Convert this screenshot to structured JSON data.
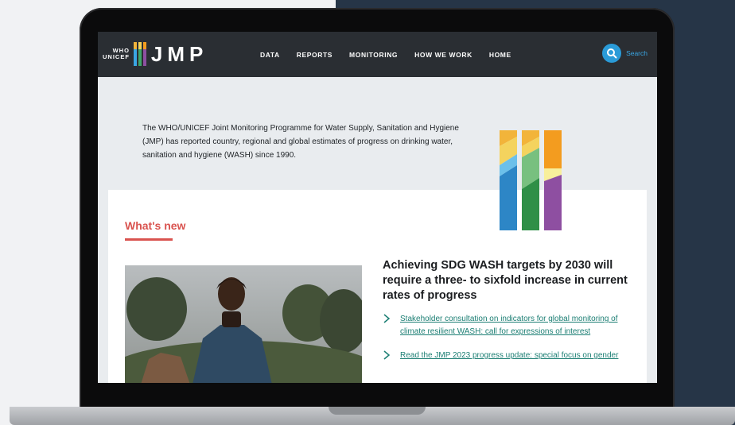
{
  "header": {
    "logo": {
      "who": "WHO",
      "unicef": "UNICEF",
      "name": "JMP"
    },
    "nav": [
      "DATA",
      "REPORTS",
      "MONITORING",
      "HOW WE WORK",
      "HOME"
    ],
    "search_label": "Search"
  },
  "intro": {
    "text": "The WHO/UNICEF Joint Monitoring Programme for Water Supply, Sanitation and Hygiene (JMP) has reported country, regional and global estimates of progress on drinking water, sanitation and hygiene (WASH) since 1990."
  },
  "whats_new": {
    "heading": "What's new",
    "headline": "Achieving SDG WASH targets by 2030 will require a three- to sixfold increase in current rates of progress",
    "links": [
      "Stakeholder consultation on indicators for global monitoring of climate resilient WASH: call for expressions of interest",
      "Read the JMP 2023 progress update: special focus on gender"
    ]
  },
  "colors": {
    "header_bg": "#2a2e33",
    "accent_red": "#d9534f",
    "link_teal": "#1b7e73",
    "search_blue": "#2a9bd8"
  },
  "icons": [
    "search-icon",
    "chevron-right-icon",
    "jmp-bars-logo"
  ]
}
